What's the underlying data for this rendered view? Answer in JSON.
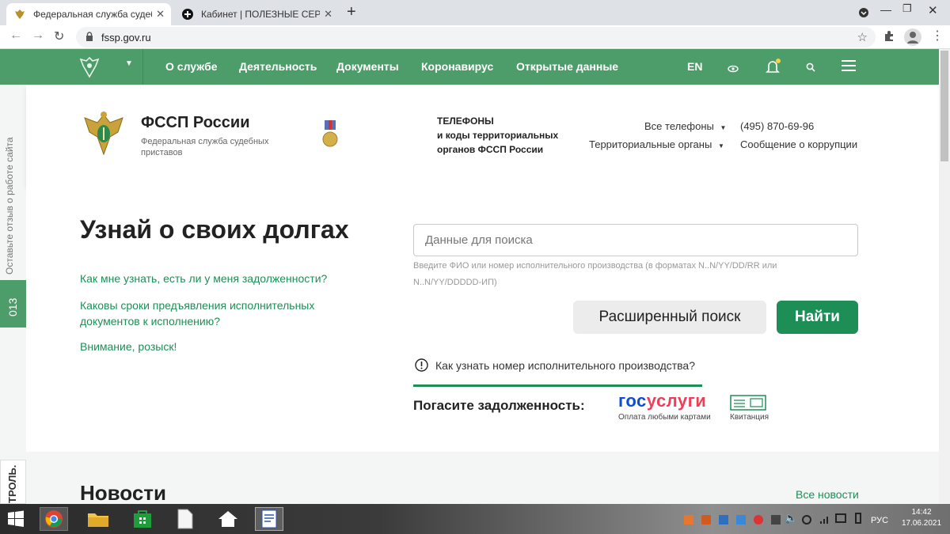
{
  "browser": {
    "tabs": [
      {
        "title": "Федеральная служба судебных"
      },
      {
        "title": "Кабинет | ПОЛЕЗНЫЕ СЕРВИСЫ"
      }
    ],
    "url": "fssp.gov.ru"
  },
  "nav": {
    "items": [
      "О службе",
      "Деятельность",
      "Документы",
      "Коронавирус",
      "Открытые данные"
    ],
    "lang": "EN"
  },
  "header": {
    "org_name": "ФССП России",
    "org_sub": "Федеральная служба судебных приставов",
    "phones_title_1": "ТЕЛЕФОНЫ",
    "phones_title_2": "и коды территориальных",
    "phones_title_3": "органов ФССП России",
    "all_phones": "Все телефоны",
    "territorial": "Территориальные органы",
    "phone": "(495) 870-69-96",
    "corruption": "Сообщение о коррупции"
  },
  "sidebar": {
    "feedback": "Оставьте отзыв о работе сайта",
    "badge": "013",
    "control": "ТРОЛЬ."
  },
  "main": {
    "title": "Узнай о своих долгах",
    "links": [
      "Как мне узнать, есть ли у меня задолженности?",
      "Каковы сроки предъявления исполнительных документов к исполнению?",
      "Внимание, розыск!"
    ],
    "search_placeholder": "Данные для поиска",
    "search_hint": "Введите ФИО или номер исполнительного производства (в форматах N..N/YY/DD/RR или N..N/YY/DDDDD-ИП)",
    "advanced": "Расширенный поиск",
    "find": "Найти",
    "how_number": "Как узнать номер исполнительного производства?",
    "pay_label": "Погасите задолженность:",
    "gosuslugi_logo_a": "гос",
    "gosuslugi_logo_b": "услуги",
    "gosuslugi_caption": "Оплата любыми картами",
    "receipt_caption": "Квитанция",
    "news_title": "Новости",
    "all_news": "Все новости"
  },
  "taskbar": {
    "lang": "РУС",
    "time": "14:42",
    "date": "17.06.2021"
  },
  "colors": {
    "green": "#1e8e57",
    "nav_green": "#4d9d6a",
    "gosuslugi_blue": "#0d4cd3",
    "gosuslugi_red": "#ee3f58"
  }
}
